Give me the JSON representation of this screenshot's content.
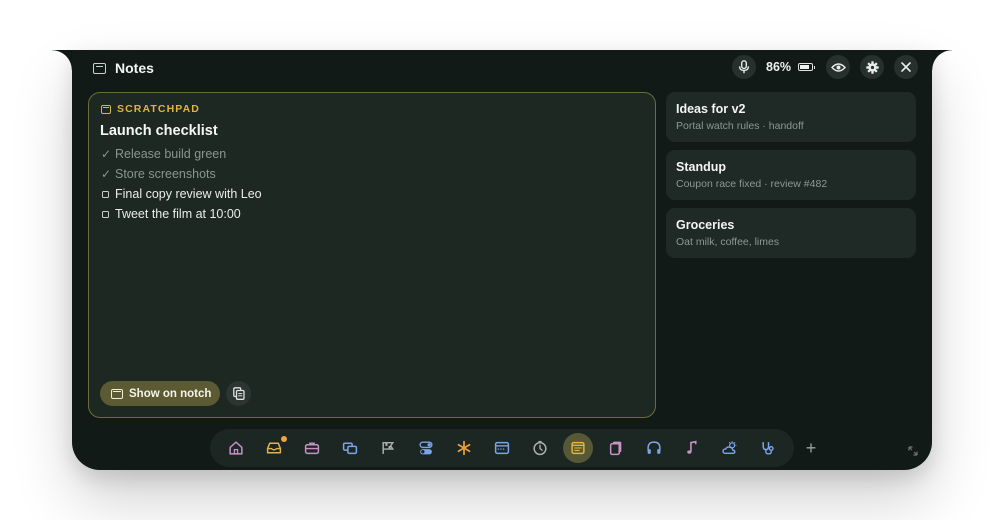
{
  "header": {
    "title": "Notes",
    "battery_percent": "86%",
    "battery_level": 0.86
  },
  "scratchpad": {
    "tag": "SCRATCHPAD",
    "title": "Launch checklist",
    "items": [
      {
        "text": "Release build green",
        "done": true
      },
      {
        "text": "Store screenshots",
        "done": true
      },
      {
        "text": "Final copy review with Leo",
        "done": false
      },
      {
        "text": "Tweet the film at 10:00",
        "done": false
      }
    ],
    "show_button": "Show on notch"
  },
  "notes": [
    {
      "title": "Ideas for v2",
      "subtitle": "Portal watch rules · handoff"
    },
    {
      "title": "Standup",
      "subtitle": "Coupon race fixed · review #482"
    },
    {
      "title": "Groceries",
      "subtitle": "Oat milk, coffee, limes"
    }
  ],
  "dock": {
    "items": [
      {
        "icon": "home-icon",
        "color": "#c792c6"
      },
      {
        "icon": "inbox-tray-icon",
        "color": "#e3b24a",
        "badge": true
      },
      {
        "icon": "briefcase-icon",
        "color": "#c792c6"
      },
      {
        "icon": "windows-icon",
        "color": "#7aa5e8"
      },
      {
        "icon": "flag-icon",
        "color": "#a9b0ad"
      },
      {
        "icon": "toggles-icon",
        "color": "#7aa5e8"
      },
      {
        "icon": "asterisk-icon",
        "color": "#e8a13a"
      },
      {
        "icon": "calendar-window-icon",
        "color": "#7aa5e8"
      },
      {
        "icon": "timer-icon",
        "color": "#a9b0ad"
      },
      {
        "icon": "notes-icon",
        "color": "#e2b43c",
        "active": true
      },
      {
        "icon": "clipboard-icon",
        "color": "#c792c6"
      },
      {
        "icon": "headphones-icon",
        "color": "#7aa5e8"
      },
      {
        "icon": "music-note-icon",
        "color": "#c792c6"
      },
      {
        "icon": "weather-icon",
        "color": "#7aa5e8"
      },
      {
        "icon": "stethoscope-icon",
        "color": "#7aa5e8"
      }
    ],
    "add_label": "+"
  },
  "colors": {
    "panel_bg": "#111a17",
    "accent": "#e2b43c",
    "card_bg": "#1f2925"
  }
}
